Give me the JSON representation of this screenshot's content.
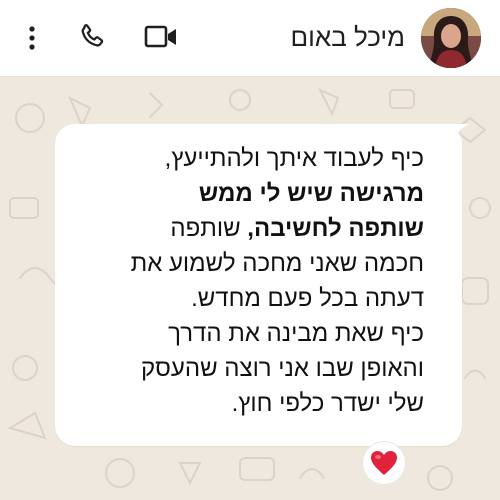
{
  "header": {
    "contact_name": "מיכל באום",
    "icons": [
      "more-vertical-icon",
      "phone-call-icon",
      "video-call-icon"
    ]
  },
  "message": {
    "line1": "כיף לעבוד איתך ולהתייעץ,",
    "line2": "מרגישה שיש לי ממש",
    "line3_bold": "שותפה לחשיבה,",
    "line3_rest": " שותפה",
    "line4": "חכמה שאני מחכה לשמוע את",
    "line5": "דעתה בכל פעם מחדש.",
    "line6": "כיף שאת מבינה את הדרך",
    "line7": "והאופן שבו אני רוצה שהעסק",
    "line8": "שלי ישדר כלפי חוץ."
  },
  "reaction": {
    "emoji": "❤️",
    "icon": "red-heart-icon"
  },
  "colors": {
    "background": "#efe8de",
    "bubble": "#ffffff",
    "header": "#ffffff",
    "heart": "#e0223a",
    "icon": "#1f1f1f"
  }
}
